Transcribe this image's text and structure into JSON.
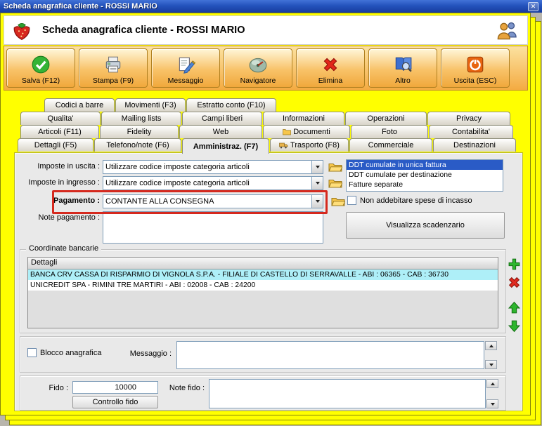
{
  "titlebar": {
    "title": "Scheda anagrafica cliente - ROSSI MARIO",
    "close_glyph": "✕"
  },
  "header": {
    "title": "Scheda anagrafica cliente - ROSSI MARIO"
  },
  "toolbar": {
    "buttons": [
      {
        "label": "Salva (F12)",
        "icon": "save-check-icon"
      },
      {
        "label": "Stampa (F9)",
        "icon": "printer-icon"
      },
      {
        "label": "Messaggio",
        "icon": "message-pencil-icon"
      },
      {
        "label": "Navigatore",
        "icon": "navigator-compass-icon"
      },
      {
        "label": "Elimina",
        "icon": "delete-x-icon"
      },
      {
        "label": "Altro",
        "icon": "book-magnifier-icon"
      },
      {
        "label": "Uscita (ESC)",
        "icon": "exit-power-icon"
      }
    ]
  },
  "tabs": {
    "row1": [
      "Codici a barre",
      "Movimenti (F3)",
      "Estratto conto (F10)"
    ],
    "row2": [
      "Qualita'",
      "Mailing lists",
      "Campi liberi",
      "Informazioni",
      "Operazioni",
      "Privacy"
    ],
    "row3": [
      "Articoli (F11)",
      "Fidelity",
      "Web",
      "Documenti",
      "Foto",
      "Contabilita'"
    ],
    "row4": [
      "Dettagli (F5)",
      "Telefono/note (F6)",
      "Amministraz. (F7)",
      "Trasporto (F8)",
      "Commerciale",
      "Destinazioni"
    ],
    "active": "Amministraz. (F7)"
  },
  "form": {
    "imposte_uscita": {
      "label": "Imposte in uscita :",
      "value": "Utilizzare codice imposte categoria articoli"
    },
    "imposte_ingresso": {
      "label": "Imposte in ingresso :",
      "value": "Utilizzare codice imposte categoria articoli"
    },
    "pagamento": {
      "label": "Pagamento :",
      "value": "CONTANTE ALLA CONSEGNA"
    },
    "note_pagamento_label": "Note pagamento :",
    "ddt_list": [
      "DDT cumulate in unica fattura",
      "DDT cumulate per destinazione",
      "Fatture separate"
    ],
    "ddt_selected": "DDT cumulate in unica fattura",
    "spese_checkbox_label": "Non addebitare spese di incasso",
    "scadenzario_button": "Visualizza scadenzario"
  },
  "banks": {
    "group_title": "Coordinate bancarie",
    "column_header": "Dettagli",
    "rows": [
      "BANCA CRV CASSA DI RISPARMIO DI VIGNOLA S.P.A. - FILIALE DI CASTELLO DI SERRAVALLE - ABI : 06365 - CAB : 36730",
      "UNICREDIT SPA - RIMINI TRE MARTIRI - ABI : 02008 - CAB : 24200"
    ],
    "selected_row": 0
  },
  "blocco": {
    "checkbox_label": "Blocco anagrafica",
    "messaggio_label": "Messaggio :"
  },
  "fido": {
    "label": "Fido :",
    "value": "10000",
    "button": "Controllo fido",
    "note_label": "Note fido :"
  },
  "colors": {
    "window_yellow": "#FFFF00",
    "highlight_red": "#D5291E",
    "selection_blue": "#2A5BC6",
    "selected_bank_cyan": "#AEEFF8",
    "titlebar_blue": "#2453BC",
    "toolbar_orange": "#F4AB42"
  }
}
